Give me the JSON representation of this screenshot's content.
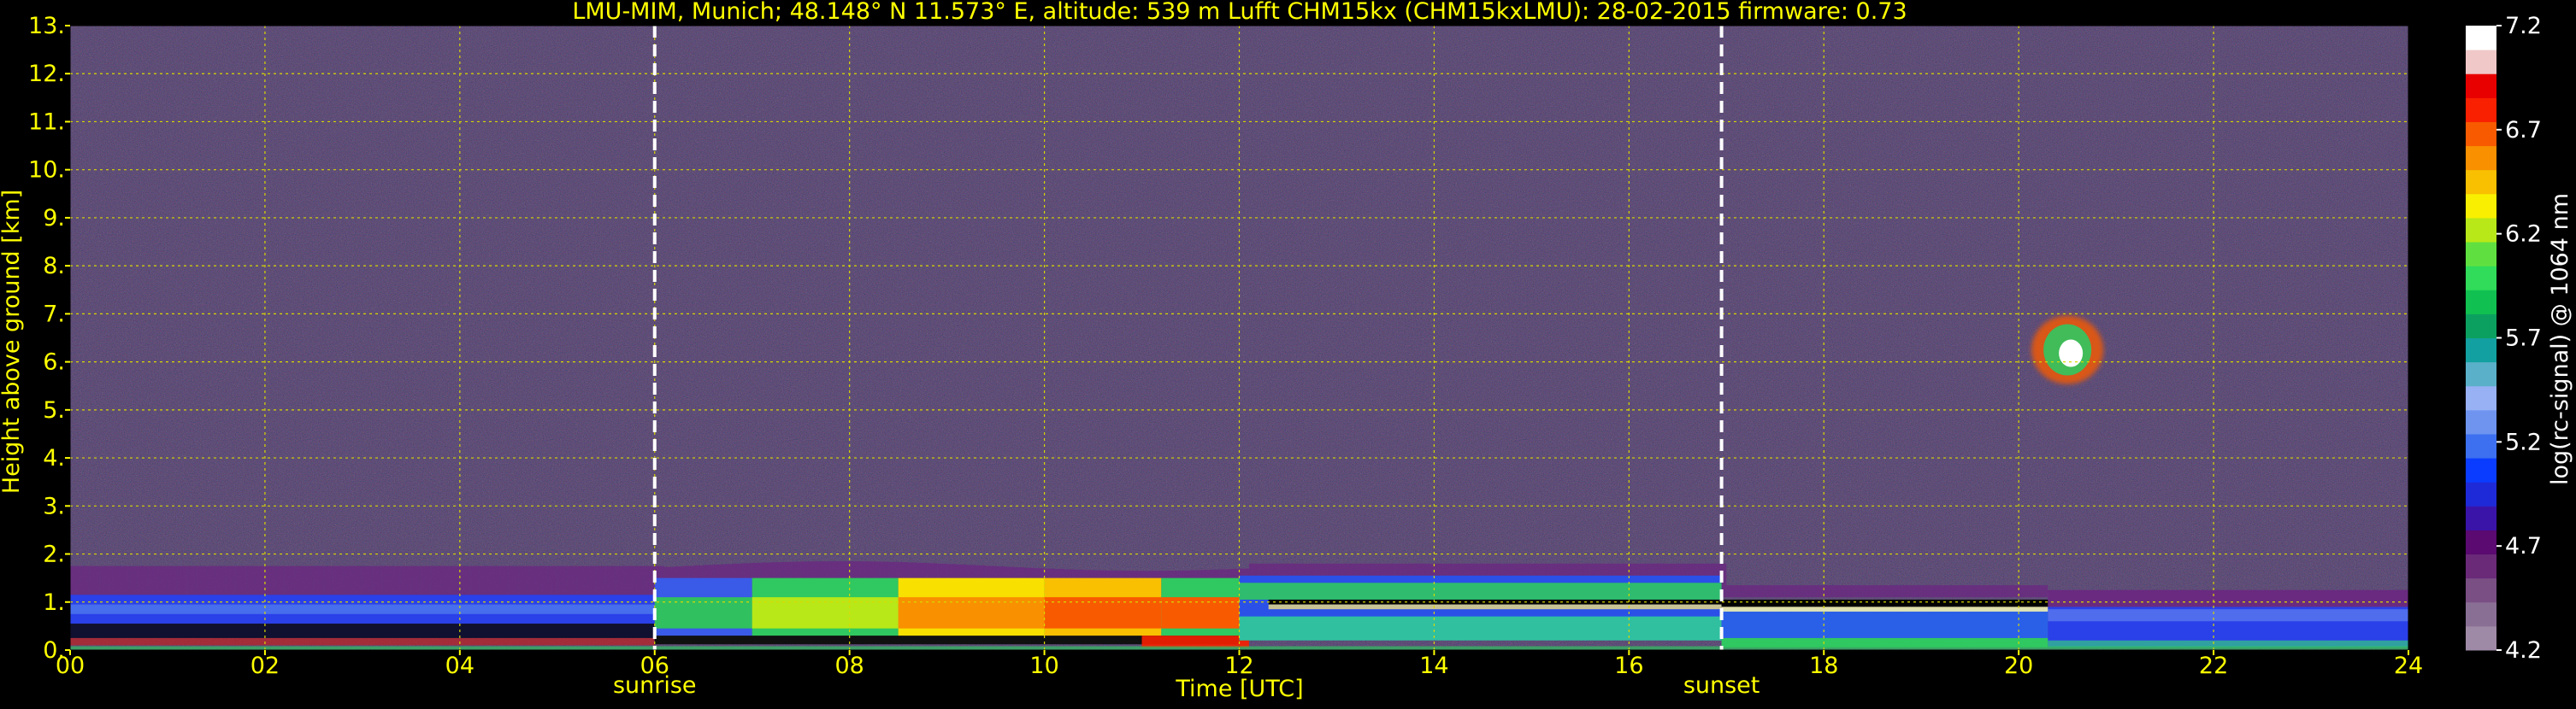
{
  "chart_data": {
    "type": "heatmap",
    "title": "LMU-MIM, Munich; 48.148° N 11.573° E, altitude: 539 m    Lufft CHM15kx (CHM15kxLMU): 28-02-2015    firmware: 0.73",
    "xlabel": "Time [UTC]",
    "ylabel": "Height above ground [km]",
    "xlim": [
      0,
      24
    ],
    "ylim": [
      0,
      13
    ],
    "x_ticks": [
      "00",
      "02",
      "04",
      "06",
      "08",
      "10",
      "12",
      "14",
      "16",
      "18",
      "20",
      "22",
      "24"
    ],
    "y_ticks": [
      "0.",
      "1.",
      "2.",
      "3.",
      "4.",
      "5.",
      "6.",
      "7.",
      "8.",
      "9.",
      "10.",
      "11.",
      "12.",
      "13."
    ],
    "grid": true,
    "markers": [
      {
        "label": "sunrise",
        "time": 6.0
      },
      {
        "label": "sunset",
        "time": 16.95
      }
    ],
    "colorbar": {
      "label": "log(rc-signal) @ 1064 nm",
      "range": [
        4.2,
        7.2
      ],
      "ticks": [
        "4.2",
        "4.7",
        "5.2",
        "5.7",
        "6.2",
        "6.7",
        "7.2"
      ],
      "colors": [
        "#9e8aa6",
        "#8a6f94",
        "#7a4f84",
        "#6a2a78",
        "#5a0a70",
        "#3a14a8",
        "#1e2ad8",
        "#0a3cff",
        "#3c70f0",
        "#6e94f0",
        "#98b0f4",
        "#5ab0c8",
        "#12a0a0",
        "#0ca060",
        "#10c050",
        "#30dc5a",
        "#60e040",
        "#b8e818",
        "#f8f000",
        "#f8c000",
        "#f89000",
        "#f85a00",
        "#f82000",
        "#e80000",
        "#f0c8c8",
        "#ffffff"
      ]
    },
    "features": [
      {
        "name": "boundary layer aerosol",
        "time_range": [
          0,
          24
        ],
        "height_range_km": [
          0.0,
          1.8
        ]
      },
      {
        "name": "cloud",
        "time_range": [
          20.2,
          20.8
        ],
        "height_range_km": [
          5.5,
          7.0
        ]
      }
    ]
  },
  "colors": {
    "text": "#ffff00",
    "grid": "#d8d800",
    "marker": "#ffffff",
    "background": "#000000",
    "cbar_text": "#ffffff"
  }
}
